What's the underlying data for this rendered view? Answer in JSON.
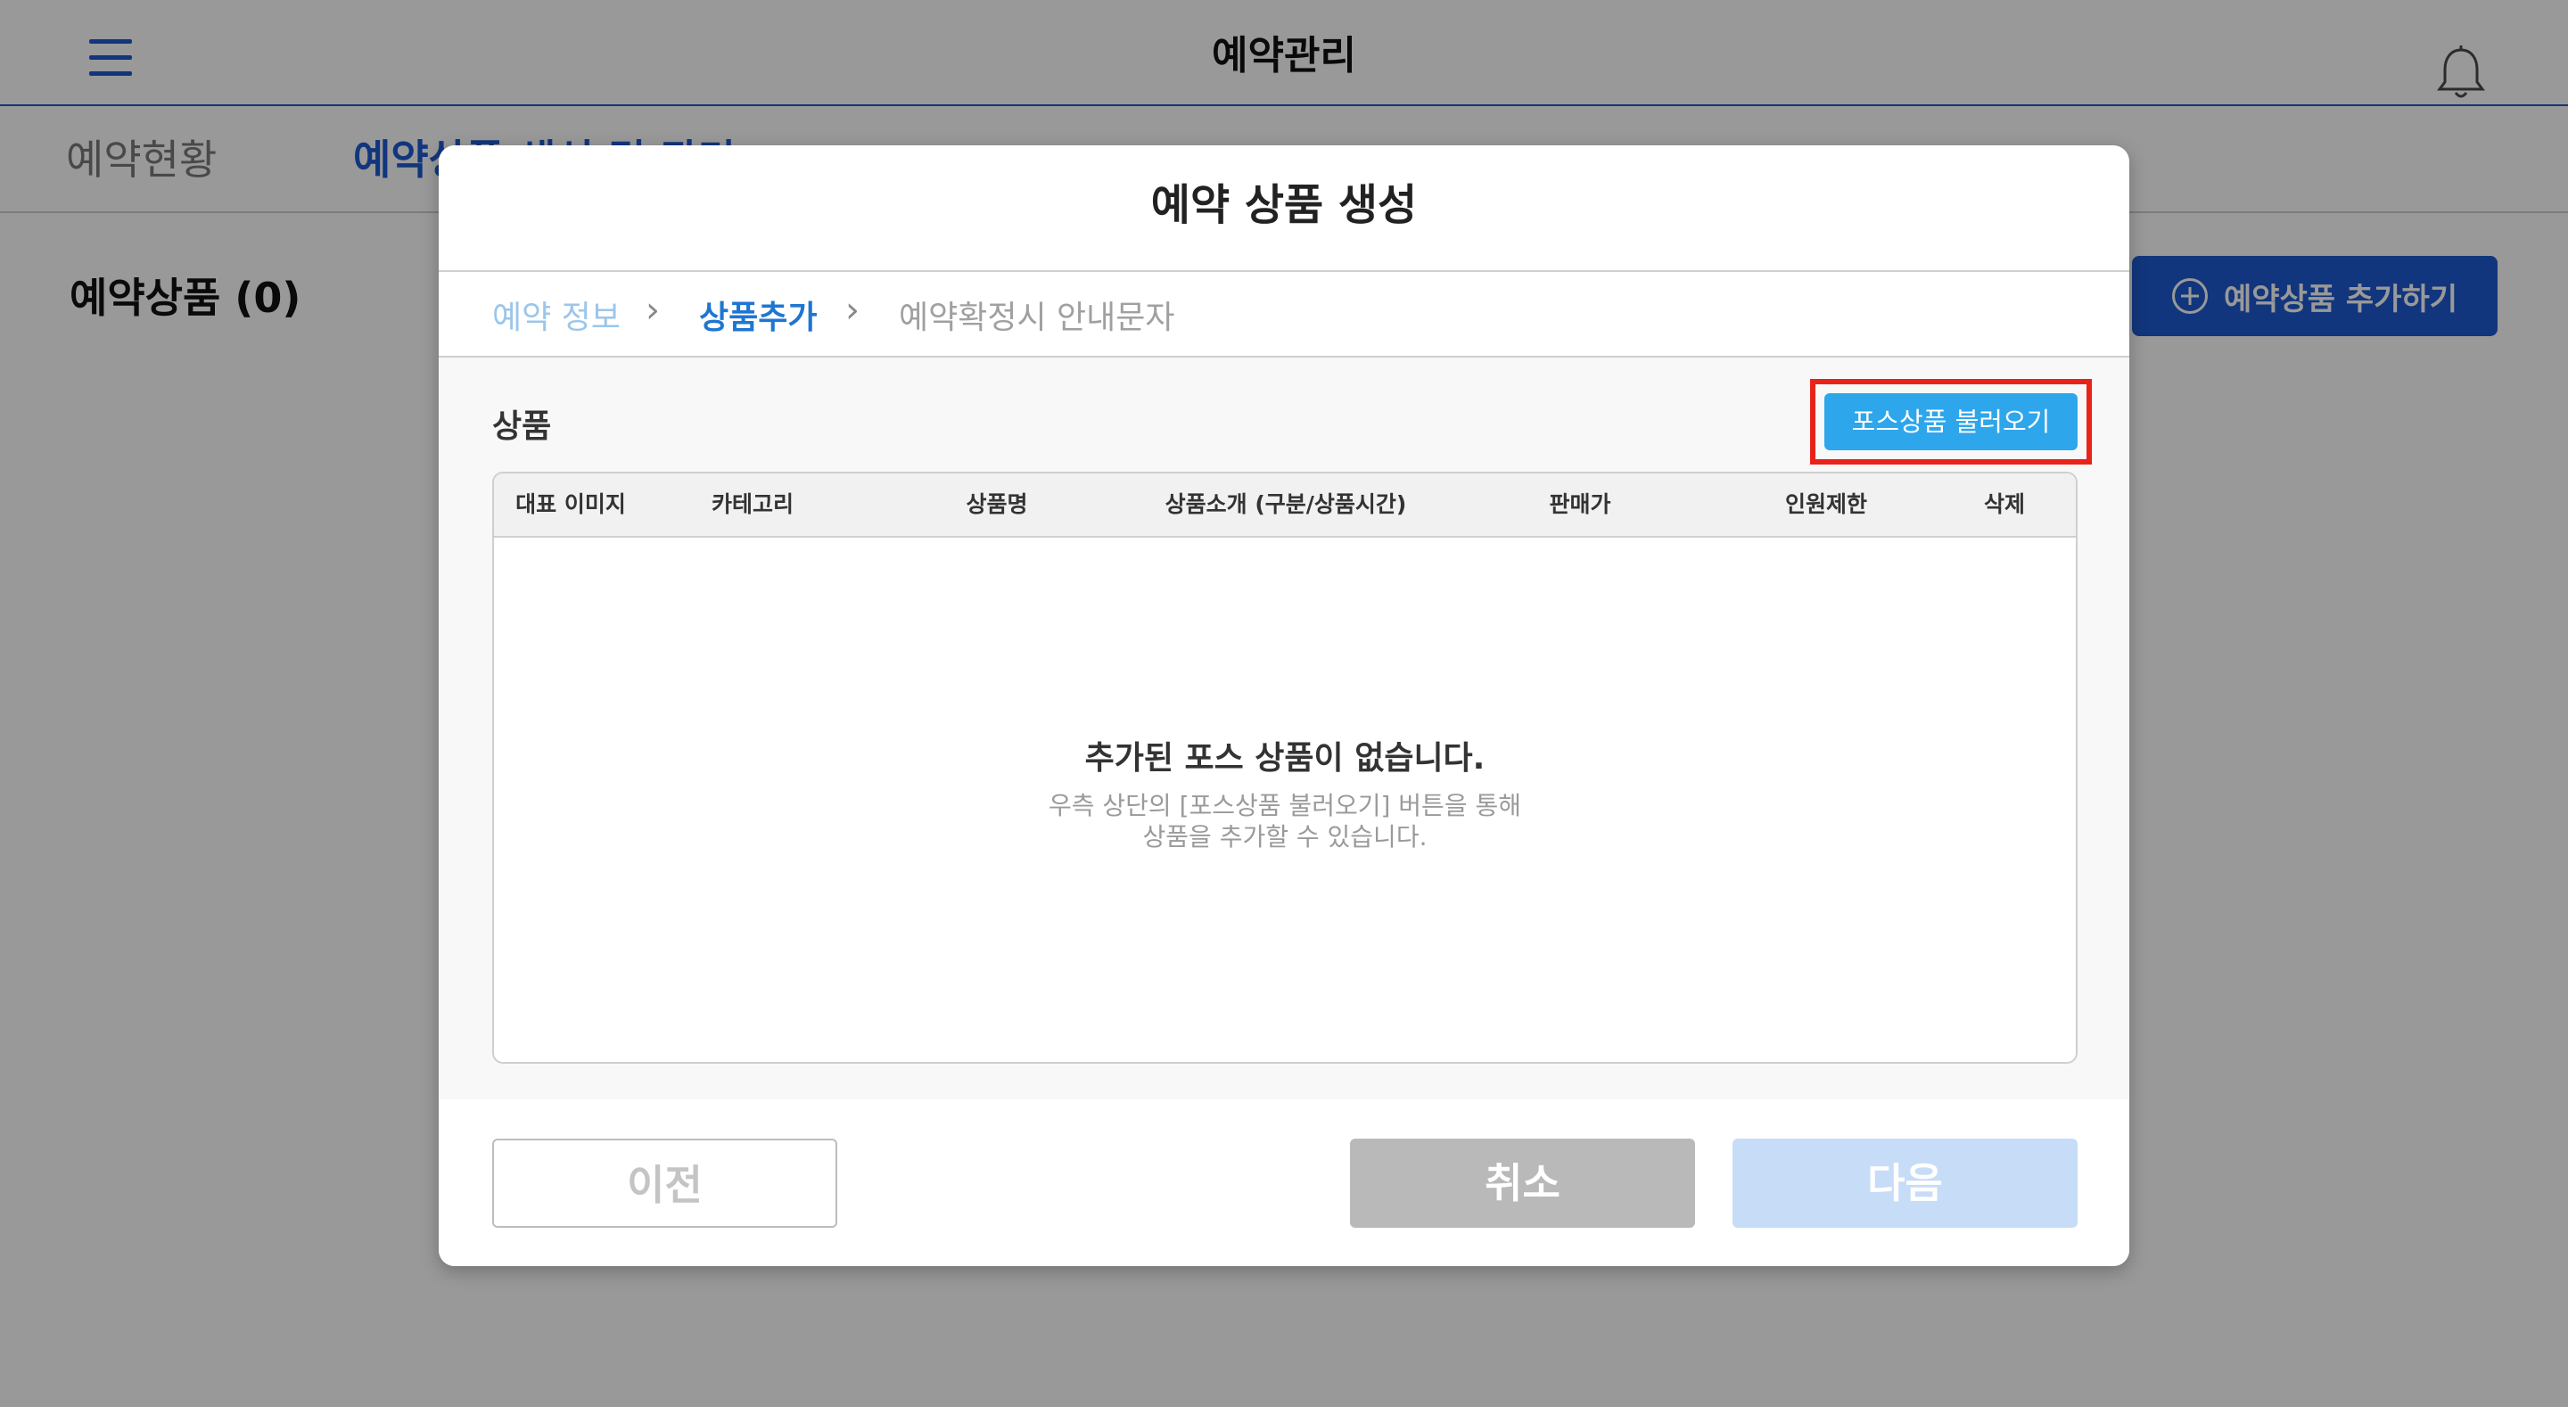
{
  "app": {
    "title": "예약관리",
    "tabs": [
      {
        "label": "예약현황"
      },
      {
        "label": "예약상품 생성 및 관리"
      }
    ],
    "heading": "예약상품 (0)",
    "add_button_label": "예약상품 추가하기"
  },
  "modal": {
    "title": "예약 상품 생성",
    "steps": [
      {
        "label": "예약 정보"
      },
      {
        "label": "상품추가"
      },
      {
        "label": "예약확정시 안내문자"
      }
    ],
    "section_label": "상품",
    "load_pos_button": "포스상품 불러오기",
    "table": {
      "columns": [
        "대표 이미지",
        "카테고리",
        "상품명",
        "상품소개 (구분/상품시간)",
        "판매가",
        "인원제한",
        "삭제"
      ],
      "empty_title": "추가된 포스 상품이 없습니다.",
      "empty_desc_line1": "우측 상단의 [포스상품 불러오기] 버튼을 통해",
      "empty_desc_line2": "상품을 추가할 수 있습니다."
    },
    "buttons": {
      "prev": "이전",
      "cancel": "취소",
      "next": "다음"
    }
  },
  "colors": {
    "primary": "#1f5bd1",
    "pos_button": "#2ea6ec",
    "highlight": "#e8231a"
  }
}
